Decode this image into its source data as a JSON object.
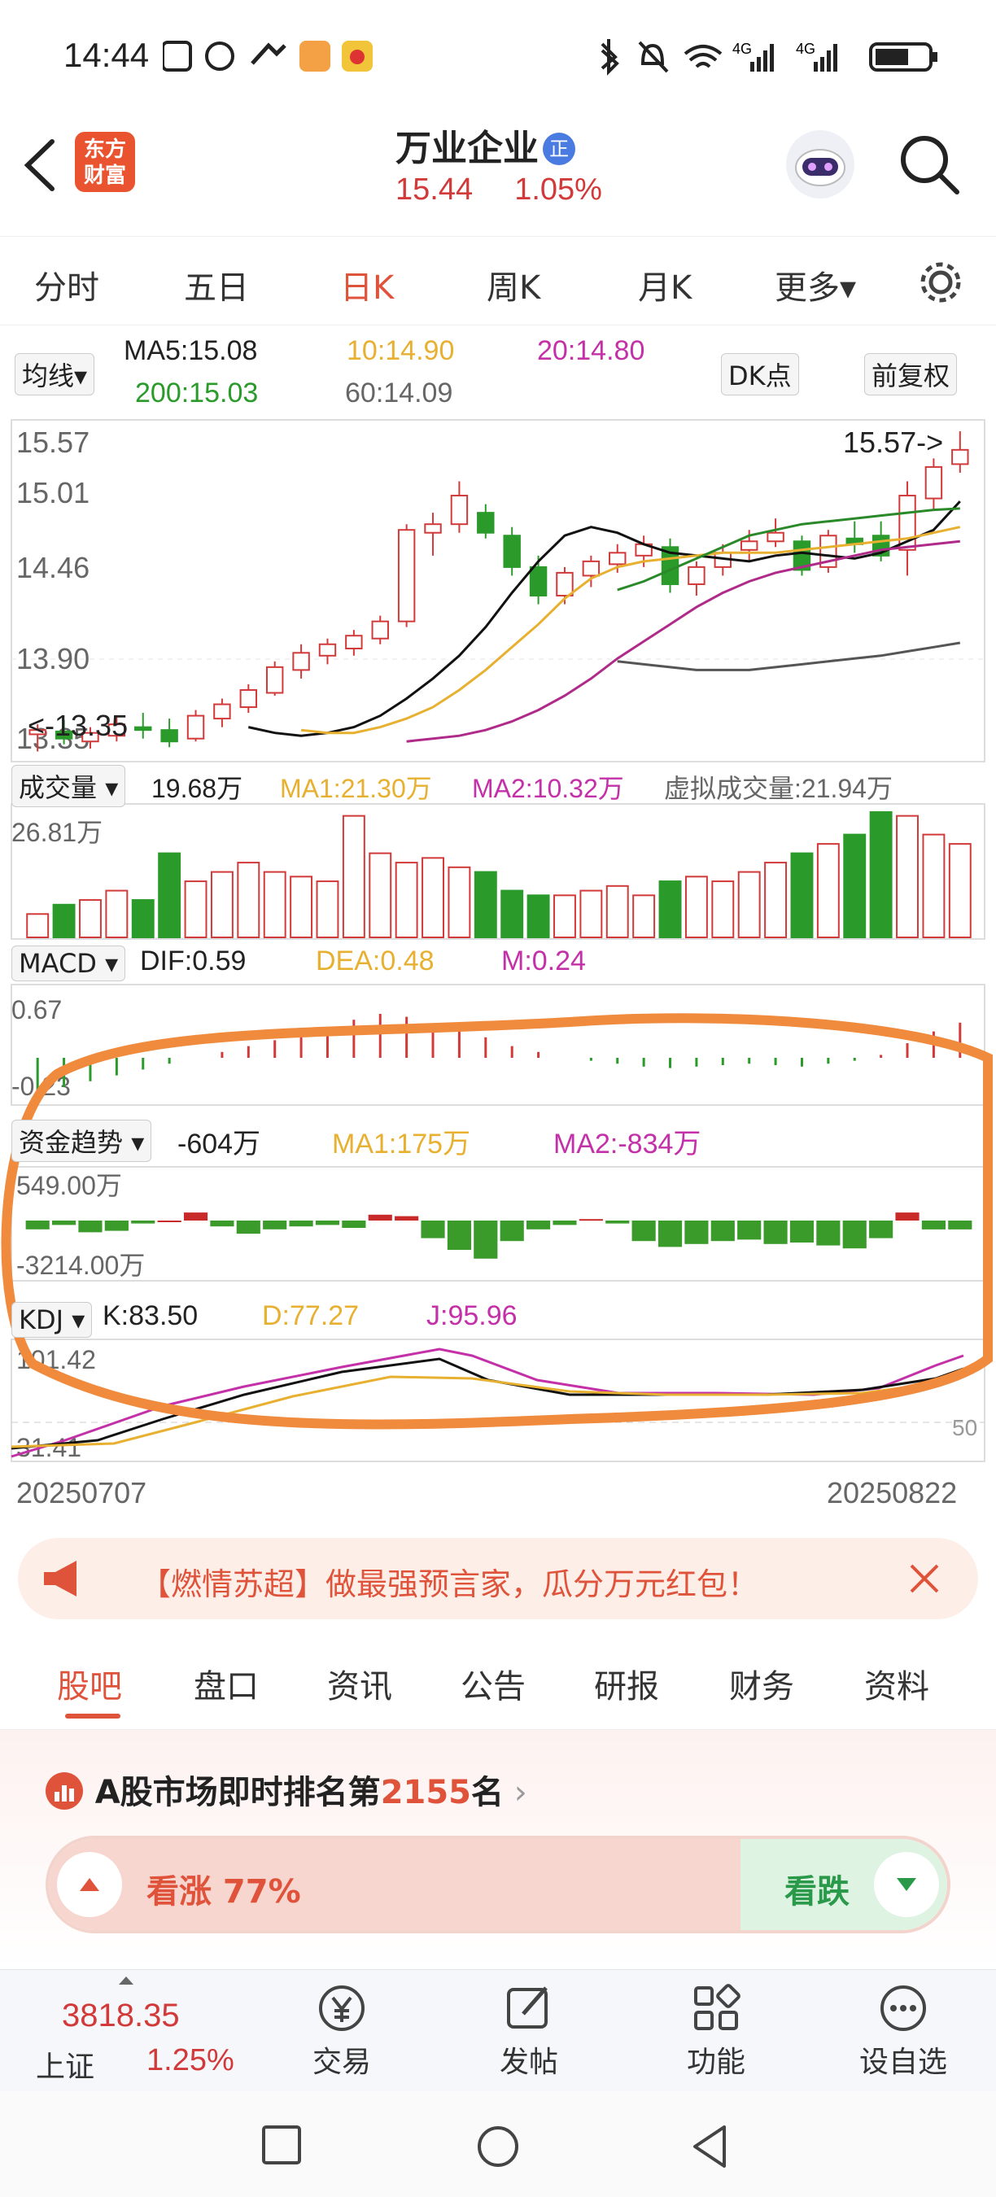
{
  "status_bar": {
    "time": "14:44"
  },
  "header": {
    "logo_line1": "东方",
    "logo_line2": "财富",
    "stock_name": "万业企业",
    "badge": "正",
    "price": "15.44",
    "change_pct": "1.05%"
  },
  "tabs": [
    {
      "label": "分时"
    },
    {
      "label": "五日"
    },
    {
      "label": "日K"
    },
    {
      "label": "周K"
    },
    {
      "label": "月K"
    },
    {
      "label": "更多▾"
    }
  ],
  "ma": {
    "selector": "均线▾",
    "ma5": "MA5:15.08",
    "ma10": "10:14.90",
    "ma20": "20:14.80",
    "ma200": "200:15.03",
    "ma60": "60:14.09",
    "dk": "DK点",
    "adjust": "前复权"
  },
  "price_axis": {
    "t1": "15.57",
    "t2": "15.01",
    "t3": "14.46",
    "t4": "13.90",
    "t5": "13.35"
  },
  "annotations": {
    "high": "15.57->",
    "low": "<-13.35"
  },
  "volume": {
    "selector": "成交量",
    "value": "19.68万",
    "ma1": "MA1:21.30万",
    "ma2": "MA2:10.32万",
    "virtual": "虚拟成交量:21.94万",
    "axis_max": "26.81万"
  },
  "macd": {
    "selector": "MACD",
    "dif": "DIF:0.59",
    "dea": "DEA:0.48",
    "m": "M:0.24",
    "axis_top": "0.67",
    "axis_bottom": "-0.23"
  },
  "fund": {
    "selector": "资金趋势",
    "value": "-604万",
    "ma1": "MA1:175万",
    "ma2": "MA2:-834万",
    "axis_top": "549.00万",
    "axis_bottom": "-3214.00万"
  },
  "kdj": {
    "selector": "KDJ",
    "k": "K:83.50",
    "d": "D:77.27",
    "j": "J:95.96",
    "axis_top": "101.42",
    "axis_bottom": "31.41",
    "ref50": "50"
  },
  "dates": {
    "start": "20250707",
    "end": "20250822"
  },
  "banner": {
    "text": "【燃情苏超】做最强预言家，瓜分万元红包！"
  },
  "subtabs": [
    {
      "label": "股吧"
    },
    {
      "label": "盘口"
    },
    {
      "label": "资讯"
    },
    {
      "label": "公告"
    },
    {
      "label": "研报"
    },
    {
      "label": "财务"
    },
    {
      "label": "资料"
    }
  ],
  "ranking": {
    "prefix": "A股市场即时排名第",
    "rank": "2155",
    "suffix": "名"
  },
  "sentiment": {
    "bull_label": "看涨 77%",
    "bull_fraction": 0.77,
    "bear_label": "看跌"
  },
  "bottom_nav": {
    "index_value": "3818.35",
    "index_name": "上证",
    "index_change": "1.25%",
    "items": [
      {
        "label": "交易"
      },
      {
        "label": "发帖"
      },
      {
        "label": "功能"
      },
      {
        "label": "设自选"
      }
    ]
  },
  "colors": {
    "up": "#d23a3a",
    "down": "#2a9a2a",
    "accent": "#e0533b",
    "highlight": "#f08a3c"
  },
  "chart_data": {
    "type": "candlestick",
    "x_range": [
      "20250707",
      "20250822"
    ],
    "ylim": [
      13.35,
      15.57
    ],
    "candles_ohlc": [
      [
        13.45,
        13.52,
        13.33,
        13.48
      ],
      [
        13.47,
        13.55,
        13.38,
        13.42
      ],
      [
        13.4,
        13.5,
        13.35,
        13.46
      ],
      [
        13.44,
        13.58,
        13.4,
        13.52
      ],
      [
        13.5,
        13.6,
        13.42,
        13.48
      ],
      [
        13.48,
        13.56,
        13.36,
        13.4
      ],
      [
        13.42,
        13.62,
        13.4,
        13.58
      ],
      [
        13.56,
        13.7,
        13.5,
        13.66
      ],
      [
        13.64,
        13.8,
        13.6,
        13.76
      ],
      [
        13.74,
        13.96,
        13.72,
        13.92
      ],
      [
        13.9,
        14.08,
        13.84,
        14.02
      ],
      [
        14.0,
        14.12,
        13.94,
        14.08
      ],
      [
        14.05,
        14.18,
        14.0,
        14.14
      ],
      [
        14.12,
        14.28,
        14.08,
        14.24
      ],
      [
        14.24,
        14.92,
        14.2,
        14.88
      ],
      [
        14.86,
        15.0,
        14.7,
        14.92
      ],
      [
        14.92,
        15.22,
        14.86,
        15.12
      ],
      [
        15.0,
        15.06,
        14.82,
        14.86
      ],
      [
        14.84,
        14.9,
        14.56,
        14.62
      ],
      [
        14.62,
        14.7,
        14.36,
        14.42
      ],
      [
        14.42,
        14.62,
        14.36,
        14.58
      ],
      [
        14.56,
        14.7,
        14.48,
        14.66
      ],
      [
        14.64,
        14.78,
        14.58,
        14.72
      ],
      [
        14.7,
        14.84,
        14.62,
        14.78
      ],
      [
        14.76,
        14.82,
        14.44,
        14.5
      ],
      [
        14.5,
        14.66,
        14.42,
        14.62
      ],
      [
        14.62,
        14.78,
        14.56,
        14.72
      ],
      [
        14.74,
        14.88,
        14.66,
        14.8
      ],
      [
        14.8,
        14.96,
        14.76,
        14.86
      ],
      [
        14.8,
        14.84,
        14.56,
        14.6
      ],
      [
        14.62,
        14.88,
        14.58,
        14.84
      ],
      [
        14.82,
        14.94,
        14.72,
        14.78
      ],
      [
        14.84,
        14.94,
        14.66,
        14.7
      ],
      [
        14.74,
        15.22,
        14.56,
        15.12
      ],
      [
        15.1,
        15.38,
        15.02,
        15.32
      ],
      [
        15.34,
        15.57,
        15.28,
        15.44
      ]
    ],
    "ma_series": [
      {
        "name": "MA5",
        "color": "#111111",
        "values": [
          13.5,
          13.46,
          13.44,
          13.46,
          13.5,
          13.58,
          13.7,
          13.84,
          14.0,
          14.2,
          14.44,
          14.66,
          14.84,
          14.9,
          14.86,
          14.78,
          14.72,
          14.7,
          14.68,
          14.66,
          14.7,
          14.72,
          14.7,
          14.68,
          14.72,
          14.8,
          14.88,
          15.08
        ]
      },
      {
        "name": "MA10",
        "color": "#e8b030",
        "values": [
          13.48,
          13.46,
          13.46,
          13.5,
          13.56,
          13.64,
          13.76,
          13.9,
          14.06,
          14.22,
          14.4,
          14.54,
          14.62,
          14.66,
          14.68,
          14.7,
          14.72,
          14.72,
          14.72,
          14.74,
          14.76,
          14.78,
          14.8,
          14.82,
          14.86,
          14.9
        ]
      },
      {
        "name": "MA20",
        "color": "#b02a8a",
        "values": [
          13.4,
          13.42,
          13.44,
          13.48,
          13.54,
          13.62,
          13.72,
          13.84,
          13.98,
          14.1,
          14.22,
          14.34,
          14.44,
          14.52,
          14.58,
          14.62,
          14.66,
          14.7,
          14.74,
          14.76,
          14.78,
          14.8
        ]
      },
      {
        "name": "MA60",
        "color": "#555555",
        "values": [
          13.96,
          13.94,
          13.92,
          13.9,
          13.9,
          13.9,
          13.92,
          13.94,
          13.96,
          13.98,
          14.0,
          14.03,
          14.06,
          14.09
        ]
      },
      {
        "name": "MA200",
        "color": "#2a8a2a",
        "values": [
          14.46,
          14.52,
          14.6,
          14.68,
          14.76,
          14.84,
          14.88,
          14.92,
          14.94,
          14.96,
          14.98,
          15.0,
          15.02,
          15.03
        ]
      }
    ],
    "volume_wan": [
      5,
      7,
      8,
      10,
      8,
      18,
      12,
      14,
      16,
      14,
      13,
      12,
      26,
      18,
      16,
      17,
      15,
      14,
      10,
      9,
      9,
      10,
      11,
      9,
      12,
      13,
      12,
      14,
      16,
      18,
      20,
      22,
      26.81,
      26,
      22,
      20
    ],
    "macd_hist": [
      -0.23,
      -0.2,
      -0.16,
      -0.12,
      -0.08,
      -0.04,
      0.0,
      0.04,
      0.08,
      0.12,
      0.16,
      0.2,
      0.26,
      0.3,
      0.28,
      0.22,
      0.18,
      0.14,
      0.08,
      0.04,
      0.0,
      -0.02,
      -0.04,
      -0.06,
      -0.07,
      -0.06,
      -0.05,
      -0.04,
      -0.05,
      -0.06,
      -0.04,
      -0.02,
      0.02,
      0.1,
      0.18,
      0.24
    ],
    "fund_wan": [
      -600,
      -300,
      -800,
      -700,
      -200,
      0,
      549,
      -400,
      -900,
      -600,
      -400,
      -300,
      -500,
      400,
      300,
      -1200,
      -2000,
      -2600,
      -1400,
      -600,
      -300,
      100,
      -200,
      -1400,
      -1800,
      -1600,
      -1400,
      -1300,
      -1600,
      -1500,
      -1700,
      -1900,
      -1200,
      549,
      -604,
      -604
    ]
  }
}
